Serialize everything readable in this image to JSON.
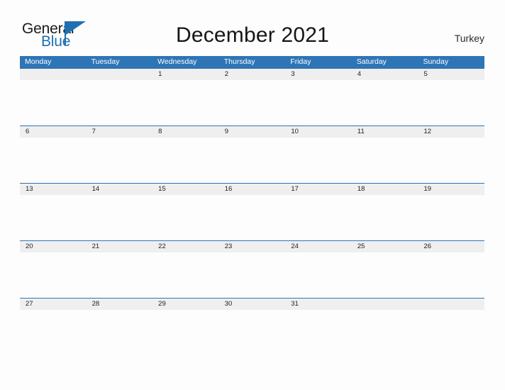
{
  "brand": {
    "line1": "General",
    "line2": "Blue",
    "flag_color": "#1f6fb2"
  },
  "header": {
    "title": "December 2021",
    "region": "Turkey"
  },
  "theme": {
    "header_blue": "#2e75b6",
    "band_gray": "#efefef",
    "page_background": "#fdfdfd",
    "text_dark": "#1c1c1c",
    "header_text": "#ffffff"
  },
  "calendar": {
    "weekdays": [
      "Monday",
      "Tuesday",
      "Wednesday",
      "Thursday",
      "Friday",
      "Saturday",
      "Sunday"
    ],
    "weeks": [
      [
        "",
        "",
        "1",
        "2",
        "3",
        "4",
        "5"
      ],
      [
        "6",
        "7",
        "8",
        "9",
        "10",
        "11",
        "12"
      ],
      [
        "13",
        "14",
        "15",
        "16",
        "17",
        "18",
        "19"
      ],
      [
        "20",
        "21",
        "22",
        "23",
        "24",
        "25",
        "26"
      ],
      [
        "27",
        "28",
        "29",
        "30",
        "31",
        "",
        ""
      ]
    ]
  }
}
